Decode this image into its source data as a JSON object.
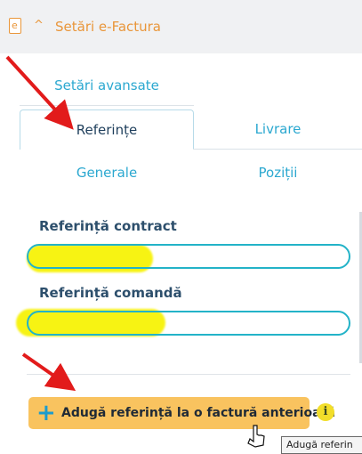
{
  "header": {
    "file_icon_letter": "e",
    "title": "Setări e-Factura"
  },
  "tabs": {
    "advanced": "Setări avansate",
    "active": "Referințe",
    "delivery": "Livrare",
    "general": "Generale",
    "positions": "Poziții"
  },
  "form": {
    "contract_label": "Referință contract",
    "contract_value": "",
    "order_label": "Referință comandă",
    "order_value": ""
  },
  "actions": {
    "add_reference_label": "Adugă referință la o factură anterioară",
    "info_glyph": "i",
    "tooltip": "Adugă referin"
  },
  "colors": {
    "accent_orange": "#e9963a",
    "link_blue": "#2ba8d0",
    "button_bg": "#f9c35f",
    "annotation_red": "#e21b1b",
    "highlighter_yellow": "#f7f200"
  }
}
